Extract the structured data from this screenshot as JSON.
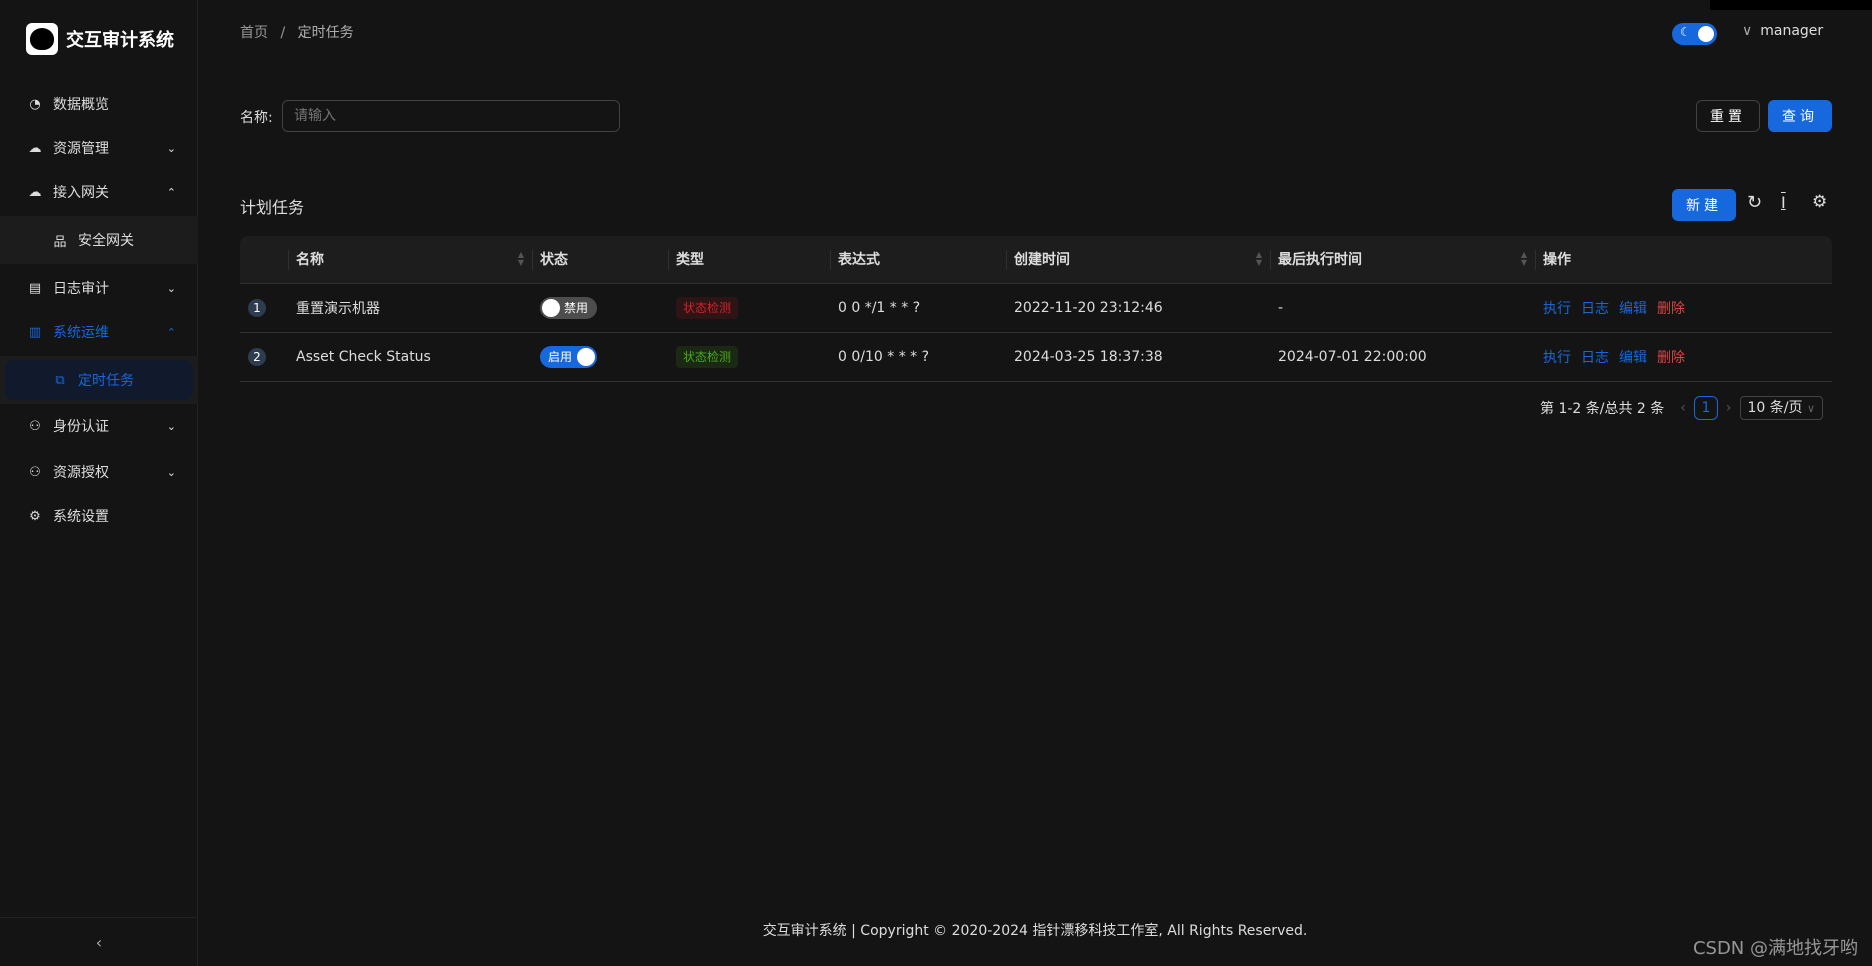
{
  "app": {
    "title": "交互审计系统"
  },
  "sidebar": {
    "items": [
      {
        "label": "数据概览",
        "icon": "dashboard-icon",
        "ic": "◔"
      },
      {
        "label": "资源管理",
        "icon": "cloud-icon",
        "ic": "☁",
        "chev": "⌄"
      },
      {
        "label": "接入网关",
        "icon": "cloud-icon",
        "ic": "☁",
        "chev": "⌃"
      },
      {
        "label": "安全网关",
        "icon": "cluster-icon",
        "ic": "品"
      },
      {
        "label": "日志审计",
        "icon": "audit-icon",
        "ic": "▤",
        "chev": "⌄"
      },
      {
        "label": "系统运维",
        "icon": "control-icon",
        "ic": "▥",
        "chev": "⌃"
      },
      {
        "label": "定时任务",
        "icon": "copy-icon",
        "ic": "⧉"
      },
      {
        "label": "身份认证",
        "icon": "user-icon",
        "ic": "⚇",
        "chev": "⌄"
      },
      {
        "label": "资源授权",
        "icon": "user-icon",
        "ic": "⚇",
        "chev": "⌄"
      },
      {
        "label": "系统设置",
        "icon": "gear-icon",
        "ic": "⚙"
      }
    ],
    "collapse": "‹"
  },
  "breadcrumb": {
    "home": "首页",
    "sep": "/",
    "current": "定时任务"
  },
  "header": {
    "user": "manager",
    "theme": "dark"
  },
  "search": {
    "label": "名称:",
    "placeholder": "请输入",
    "reset": "重置",
    "query": "查询"
  },
  "table": {
    "title": "计划任务",
    "new": "新建",
    "columns": [
      "名称",
      "状态",
      "类型",
      "表达式",
      "创建时间",
      "最后执行时间",
      "操作"
    ],
    "rows": [
      {
        "index": "1",
        "name": "重置演示机器",
        "status": "禁用",
        "enabled": false,
        "type": "状态检测",
        "type_color": "#d32029",
        "expr": "0 0 */1 * * ?",
        "created": "2022-11-20 23:12:46",
        "last": "-"
      },
      {
        "index": "2",
        "name": "Asset Check Status",
        "status": "启用",
        "enabled": true,
        "type": "状态检测",
        "type_color": "#49aa19",
        "expr": "0 0/10 * * * ?",
        "created": "2024-03-25 18:37:38",
        "last": "2024-07-01 22:00:00"
      }
    ],
    "actions": [
      "执行",
      "日志",
      "编辑",
      "删除"
    ]
  },
  "pagination": {
    "summary": "第 1-2 条/总共 2 条",
    "page": "1",
    "size": "10 条/页"
  },
  "footer": "交互审计系统 | Copyright © 2020-2024 指针漂移科技工作室, All Rights Reserved.",
  "watermark": "CSDN @满地找牙哟",
  "colors": {
    "primary": "#1668dc",
    "danger": "#dc4446"
  }
}
